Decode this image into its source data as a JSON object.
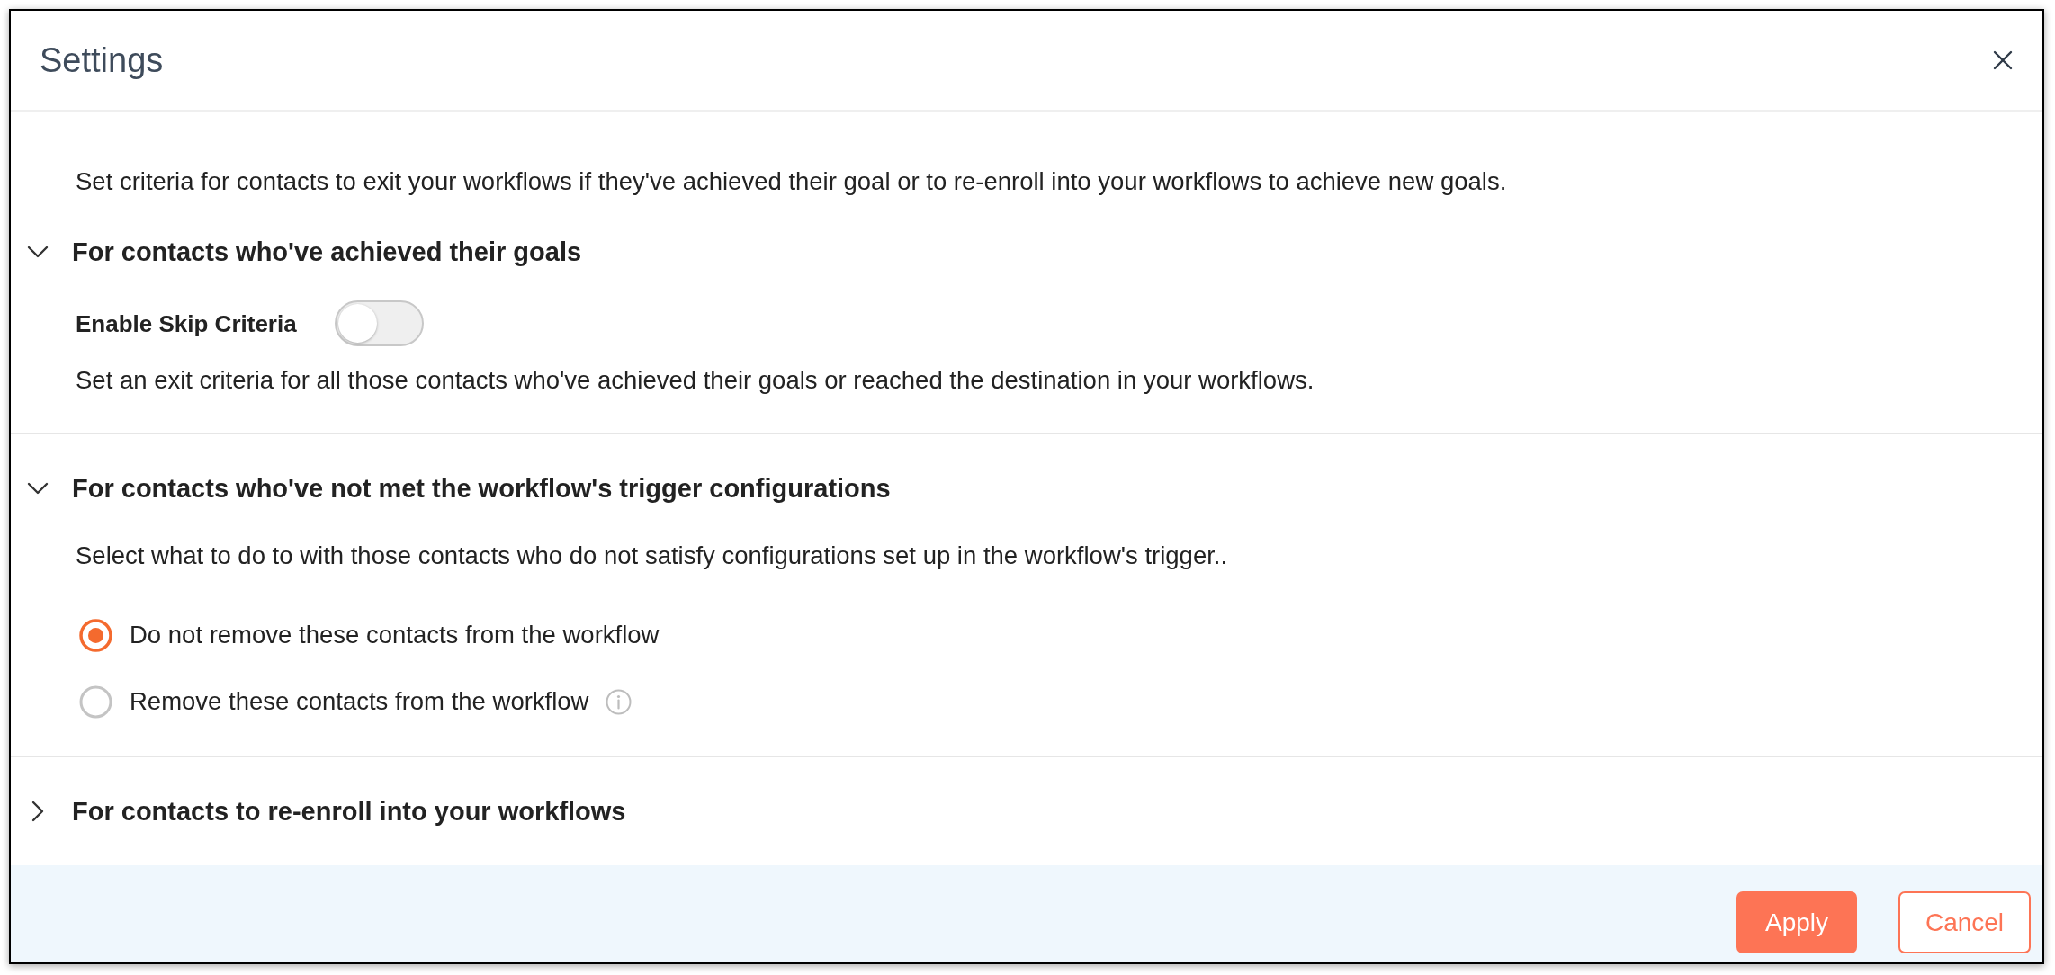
{
  "dialog": {
    "title": "Settings"
  },
  "intro": "Set criteria for contacts to exit your workflows if they've achieved their goal or to re-enroll into your workflows to achieve new goals.",
  "sections": [
    {
      "heading": "For contacts who've achieved their goals",
      "expanded": true,
      "kind": "toggle",
      "toggle": {
        "label": "Enable Skip Criteria",
        "on": false
      },
      "description": "Set an exit criteria for all those contacts who've achieved their goals or reached the destination in your workflows."
    },
    {
      "heading": "For contacts who've not met the workflow's trigger configurations",
      "expanded": true,
      "kind": "radio",
      "description": "Select what to do to with those contacts who do not satisfy configurations set up in the workflow's trigger..",
      "options": [
        {
          "label": "Do not remove these contacts from the workflow",
          "selected": true,
          "info": false
        },
        {
          "label": "Remove these contacts from the workflow",
          "selected": false,
          "info": true
        }
      ]
    },
    {
      "heading": "For contacts to re-enroll into your workflows",
      "expanded": false
    }
  ],
  "buttons": [
    {
      "label": "Apply",
      "kind": "primary"
    },
    {
      "label": "Cancel",
      "kind": "secondary"
    }
  ]
}
